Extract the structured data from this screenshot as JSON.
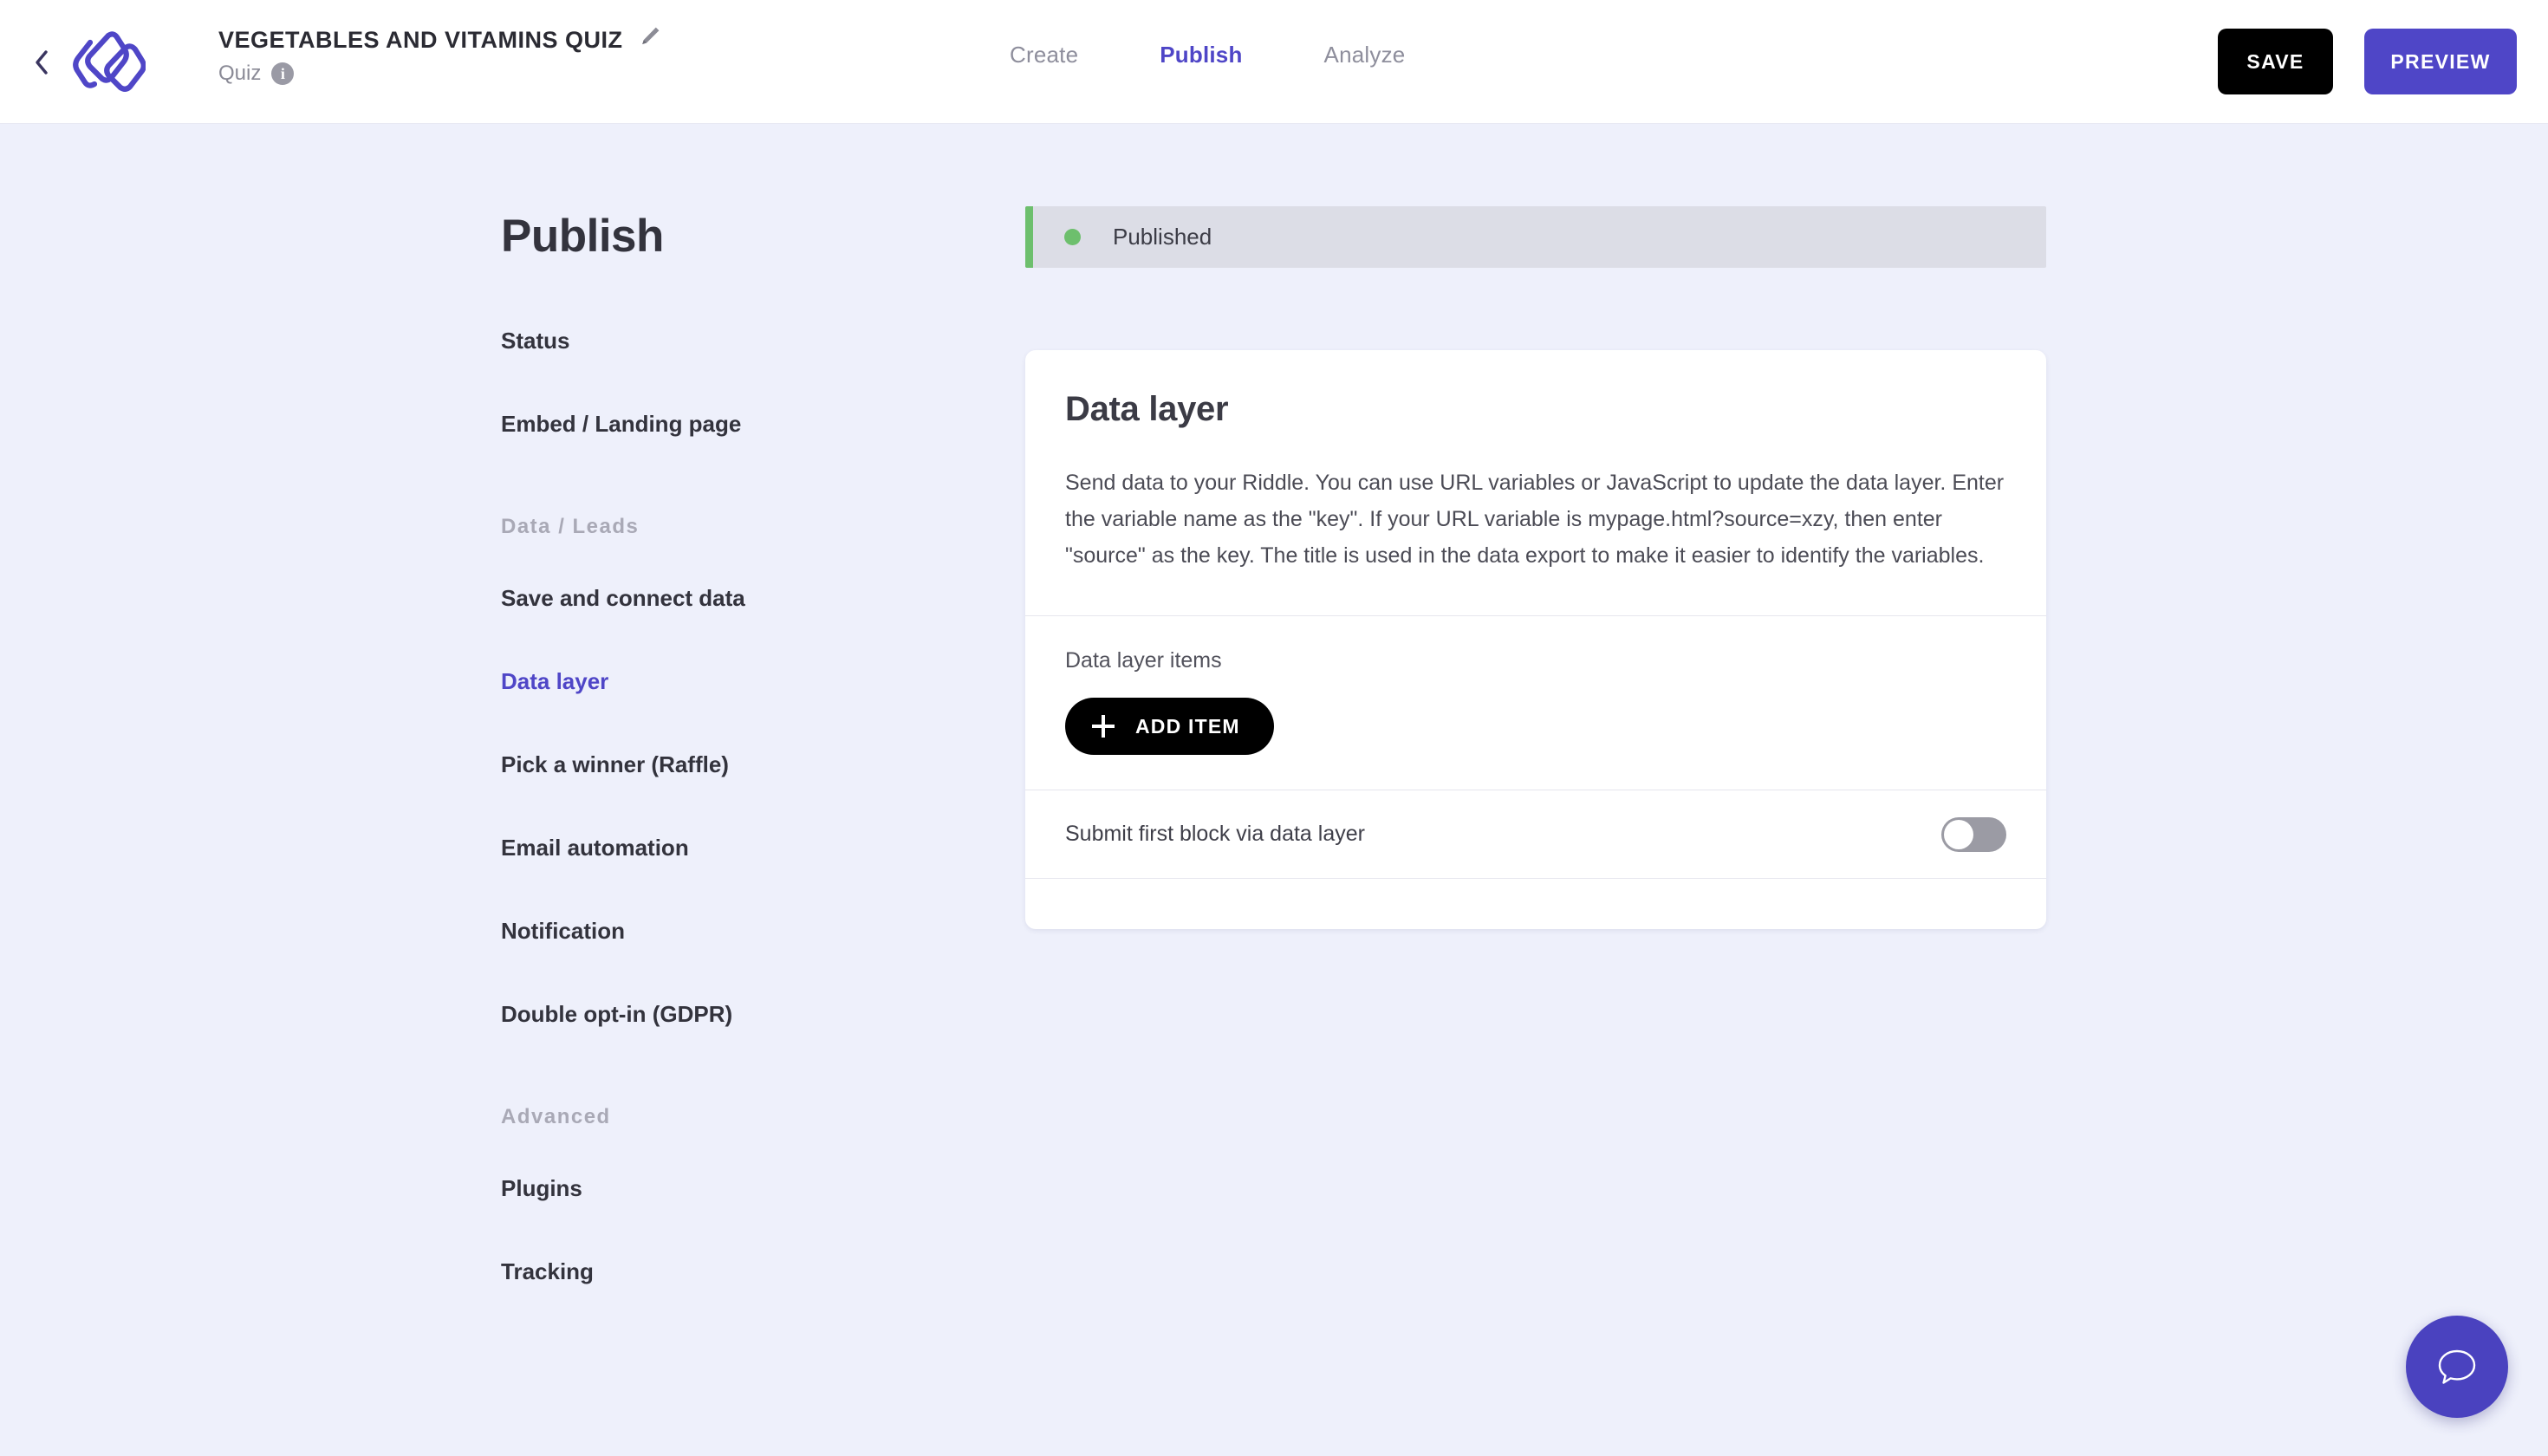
{
  "topbar": {
    "back_icon": "chevron-left-icon",
    "logo_icon": "riddle-logo-icon",
    "riddle_title": "VEGETABLES AND VITAMINS QUIZ",
    "edit_icon": "pencil-icon",
    "riddle_type": "Quiz",
    "info_icon": "info-icon",
    "info_glyph": "i",
    "tabs": [
      {
        "label": "Create",
        "active": false
      },
      {
        "label": "Publish",
        "active": true
      },
      {
        "label": "Analyze",
        "active": false
      }
    ],
    "save_label": "SAVE",
    "preview_label": "PREVIEW"
  },
  "sidebar": {
    "heading": "Publish",
    "items": [
      {
        "label": "Status"
      },
      {
        "label": "Embed / Landing page"
      }
    ],
    "group_data_label": "Data / Leads",
    "data_items": [
      {
        "label": "Save and connect data"
      },
      {
        "label": "Data layer"
      },
      {
        "label": "Pick a winner (Raffle)"
      },
      {
        "label": "Email automation"
      },
      {
        "label": "Notification"
      },
      {
        "label": "Double opt-in (GDPR)"
      }
    ],
    "group_advanced_label": "Advanced",
    "advanced_items": [
      {
        "label": "Plugins"
      },
      {
        "label": "Tracking"
      }
    ]
  },
  "status": {
    "label": "Published",
    "dot_color": "#6dbf6d",
    "bar_color": "#dcdde6"
  },
  "card": {
    "title": "Data layer",
    "description": "Send data to your Riddle. You can use URL variables or JavaScript to update the data layer. Enter the variable name as the \"key\". If your URL variable is mypage.html?source=xzy, then enter \"source\" as the key. The title is used in the data export to make it easier to identify the variables.",
    "items_label": "Data layer items",
    "add_item_label": "ADD ITEM",
    "add_item_icon": "plus-icon",
    "toggle_label": "Submit first block via data layer",
    "toggle_state": "off"
  },
  "chat": {
    "icon": "chat-bubble-icon"
  },
  "colors": {
    "accent": "#4f46c7",
    "page_background": "#eef0fb",
    "card_background": "#ffffff",
    "published_green": "#6dbf6d",
    "black_button": "#000000"
  }
}
